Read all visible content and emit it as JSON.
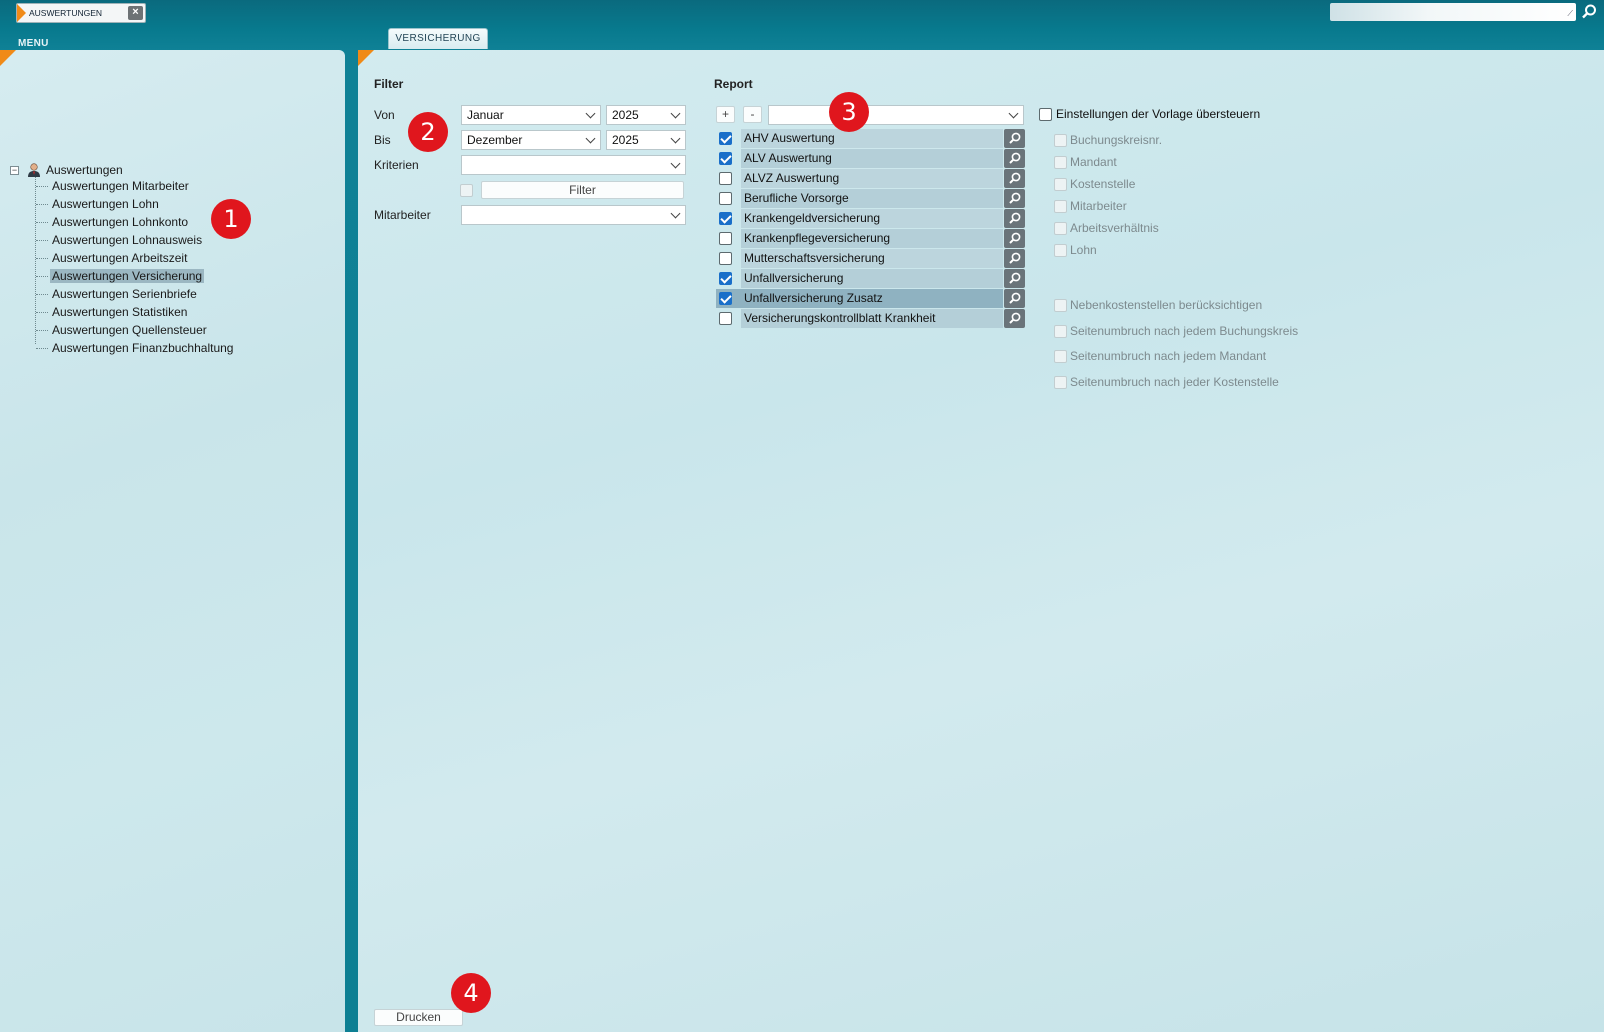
{
  "topbar": {
    "app_tab_label": "AUSWERTUNGEN",
    "menu_label": "MENU",
    "section_tab_label": "VERSICHERUNG",
    "search_value": ""
  },
  "tree": {
    "root_label": "Auswertungen",
    "items": [
      {
        "label": "Auswertungen Mitarbeiter",
        "selected": false
      },
      {
        "label": "Auswertungen Lohn",
        "selected": false
      },
      {
        "label": "Auswertungen Lohnkonto",
        "selected": false
      },
      {
        "label": "Auswertungen Lohnausweis",
        "selected": false
      },
      {
        "label": "Auswertungen Arbeitszeit",
        "selected": false
      },
      {
        "label": "Auswertungen Versicherung",
        "selected": true
      },
      {
        "label": "Auswertungen Serienbriefe",
        "selected": false
      },
      {
        "label": "Auswertungen Statistiken",
        "selected": false
      },
      {
        "label": "Auswertungen Quellensteuer",
        "selected": false
      },
      {
        "label": "Auswertungen Finanzbuchhaltung",
        "selected": false
      }
    ]
  },
  "filter": {
    "heading": "Filter",
    "von_label": "Von",
    "von_month": "Januar",
    "von_year": "2025",
    "bis_label": "Bis",
    "bis_month": "Dezember",
    "bis_year": "2025",
    "kriterien_label": "Kriterien",
    "kriterien_value": "",
    "filter_button": "Filter",
    "mitarbeiter_label": "Mitarbeiter",
    "mitarbeiter_value": ""
  },
  "report": {
    "heading": "Report",
    "add_button": "+",
    "remove_button": "-",
    "template_value": "",
    "items": [
      {
        "label": "AHV Auswertung",
        "checked": true
      },
      {
        "label": "ALV Auswertung",
        "checked": true
      },
      {
        "label": "ALVZ Auswertung",
        "checked": false
      },
      {
        "label": "Berufliche Vorsorge",
        "checked": false
      },
      {
        "label": "Krankengeldversicherung",
        "checked": true
      },
      {
        "label": "Krankenpflegeversicherung",
        "checked": false
      },
      {
        "label": "Mutterschaftsversicherung",
        "checked": false
      },
      {
        "label": "Unfallversicherung",
        "checked": true
      },
      {
        "label": "Unfallversicherung Zusatz",
        "checked": true,
        "selected": true
      },
      {
        "label": "Versicherungskontrollblatt Krankheit",
        "checked": false
      }
    ]
  },
  "options": {
    "override_label": "Einstellungen der Vorlage übersteuern",
    "grouping": [
      "Buchungskreisnr.",
      "Mandant",
      "Kostenstelle",
      "Mitarbeiter",
      "Arbeitsverhältnis",
      "Lohn"
    ],
    "extras": [
      "Nebenkostenstellen berücksichtigen",
      "Seitenumbruch nach jedem Buchungskreis",
      "Seitenumbruch nach jedem Mandant",
      "Seitenumbruch nach jeder Kostenstelle"
    ]
  },
  "actions": {
    "print_button": "Drucken"
  },
  "annotations": {
    "badge_1": "1",
    "badge_2": "2",
    "badge_3": "3",
    "badge_4": "4"
  },
  "colors": {
    "accent_orange": "#f08a17",
    "checkbox_blue": "#1a6fc9",
    "badge_red": "#e0161d",
    "topbar_teal": "#087a8e"
  }
}
